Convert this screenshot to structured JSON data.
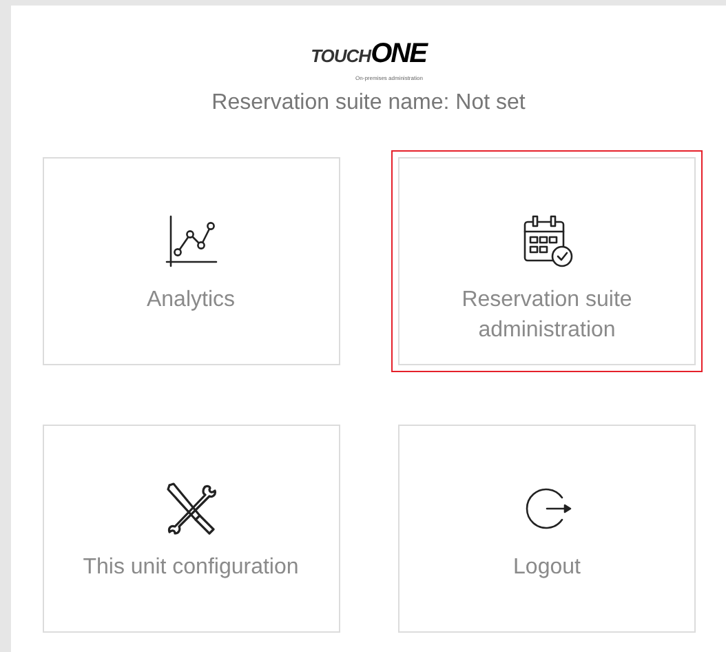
{
  "logo": {
    "part_1": "TOUCH",
    "part_2": "ONE",
    "tagline": "On-premises administration"
  },
  "suite_name": "Reservation suite name: Not set",
  "tiles": [
    {
      "label": "Analytics",
      "kind": "chart",
      "selected": false
    },
    {
      "label": "Reservation suite administration",
      "kind": "calendar",
      "selected": true
    },
    {
      "label": "This unit configuration",
      "kind": "tools",
      "selected": false
    },
    {
      "label": "Logout",
      "kind": "logout",
      "selected": false
    }
  ]
}
